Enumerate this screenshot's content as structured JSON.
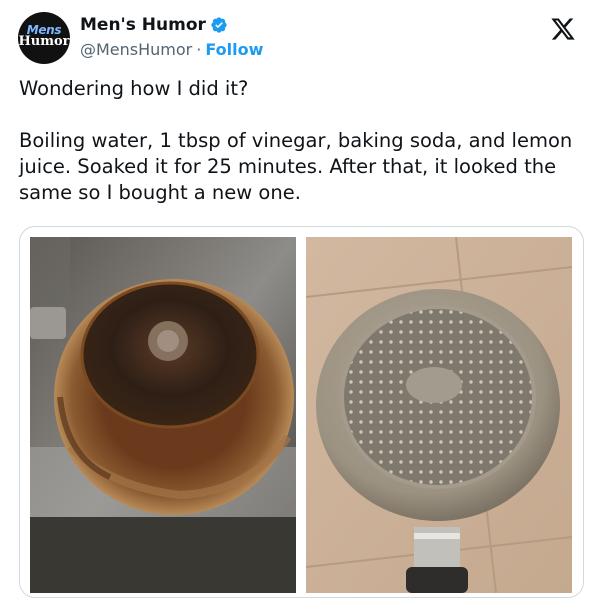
{
  "account": {
    "display_name": "Men's Humor",
    "handle": "@MensHumor",
    "separator": "·",
    "follow_label": "Follow",
    "avatar_logo_top": "Mens",
    "avatar_logo_bottom": "Humor"
  },
  "tweet": {
    "line1": "Wondering how I did it?",
    "line2": "Boiling water, 1 tbsp of vinegar, baking soda, and lemon juice. Soaked it for 25 minutes. After that, it looked the same so I bought a new one."
  },
  "media": {
    "images": [
      {
        "icon": "burnt-pan-photo"
      },
      {
        "icon": "new-pan-photo"
      }
    ]
  },
  "colors": {
    "link": "#1d9bf0",
    "verified": "#1d9bf0",
    "secondary_text": "#536471",
    "border": "#cfd9de"
  },
  "icons": {
    "verified": "verified-badge-icon",
    "platform": "x-logo-icon"
  }
}
